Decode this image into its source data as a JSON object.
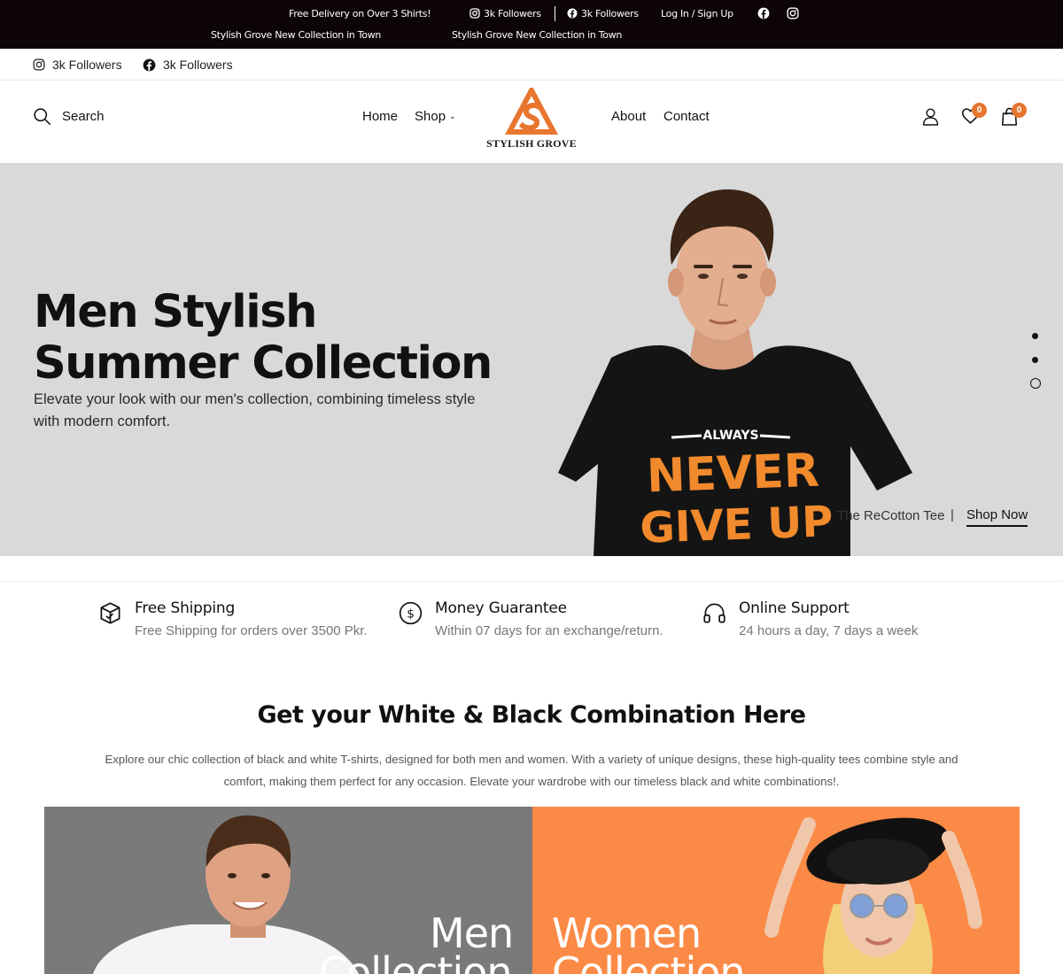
{
  "topbar": {
    "free_delivery": "Free Delivery on Over 3 Shirts!",
    "collection_note_1": "Stylish Grove New Collection in Town",
    "collection_note_2": "Stylish Grove New Collection in Town",
    "instagram_followers": "3k Followers",
    "facebook_followers": "3k Followers",
    "login": "Log In / Sign Up"
  },
  "social": {
    "instagram_followers": "3k Followers",
    "facebook_followers": "3k Followers"
  },
  "header": {
    "search_label": "Search",
    "nav": [
      "Home",
      "Shop",
      "About",
      "Contact"
    ],
    "brand": "STYLISH GROVE",
    "wishlist_count": "0",
    "cart_count": "0"
  },
  "hero": {
    "title_line1": "Men Stylish",
    "title_line2": "Summer Collection",
    "description": "Elevate your look with our men's collection, combining timeless style with modern comfort.",
    "product_name": "The ReCotton Tee",
    "separator": "|",
    "cta": "Shop Now",
    "shirt_text_top": "ALWAYS",
    "shirt_text_1": "NEVER",
    "shirt_text_2": "GIVE UP",
    "slides": 3,
    "active_slide": 3
  },
  "features": [
    {
      "title": "Free Shipping",
      "subtitle": "Free Shipping for orders over 3500 Pkr.",
      "icon": "box-icon"
    },
    {
      "title": "Money Guarantee",
      "subtitle": "Within 07 days for an exchange/return.",
      "icon": "dollar-coin-icon"
    },
    {
      "title": "Online Support",
      "subtitle": "24 hours a day, 7 days a week",
      "icon": "headphones-icon"
    }
  ],
  "section": {
    "title": "Get your White & Black Combination Here",
    "description": "Explore our chic collection of black and white T-shirts, designed for both men and women. With a variety of unique designs, these high-quality tees combine style and comfort, making them perfect for any occasion. Elevate your wardrobe with our timeless black and white combinations!."
  },
  "collections": {
    "men_line1": "Men",
    "men_line2": "Collection",
    "women_line1": "Women",
    "women_line2": "Collection"
  },
  "colors": {
    "accent": "#e8762f",
    "topbar_bg": "#0c0406",
    "hero_bg": "#d9d9d9",
    "men_card": "#7a7a7a",
    "women_card": "#fb8a46"
  }
}
